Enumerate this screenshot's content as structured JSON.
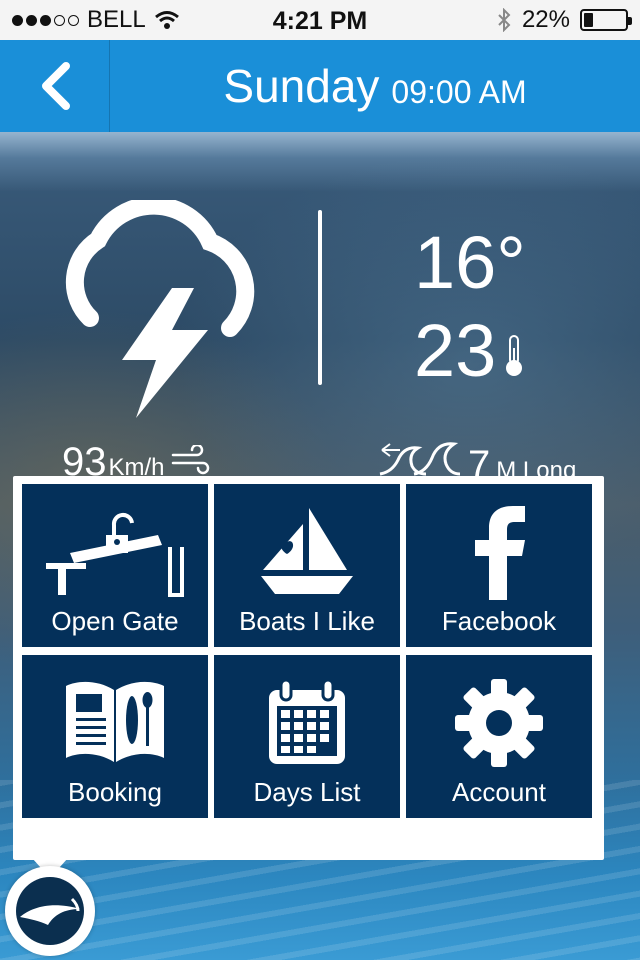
{
  "status": {
    "carrier": "BELL",
    "time": "4:21 PM",
    "battery": "22%",
    "battery_level": 0.22
  },
  "nav": {
    "day": "Sunday",
    "time": "09:00 AM"
  },
  "weather": {
    "icon": "thunderstorm-icon",
    "temp_high": "16°",
    "temp_low": "23",
    "wind_speed": "93",
    "wind_unit": "Km/h",
    "wave_height": "7",
    "wave_unit": "M Long"
  },
  "menu": {
    "items": [
      {
        "label": "Open Gate",
        "icon": "gate-icon"
      },
      {
        "label": "Boats I Like",
        "icon": "sailboat-icon"
      },
      {
        "label": "Facebook",
        "icon": "facebook-icon"
      },
      {
        "label": "Booking",
        "icon": "brochure-icon"
      },
      {
        "label": "Days List",
        "icon": "calendar-icon"
      },
      {
        "label": "Account",
        "icon": "gear-icon"
      }
    ]
  },
  "colors": {
    "nav": "#1a8fd8",
    "tile": "#04305a",
    "text": "#ffffff"
  }
}
